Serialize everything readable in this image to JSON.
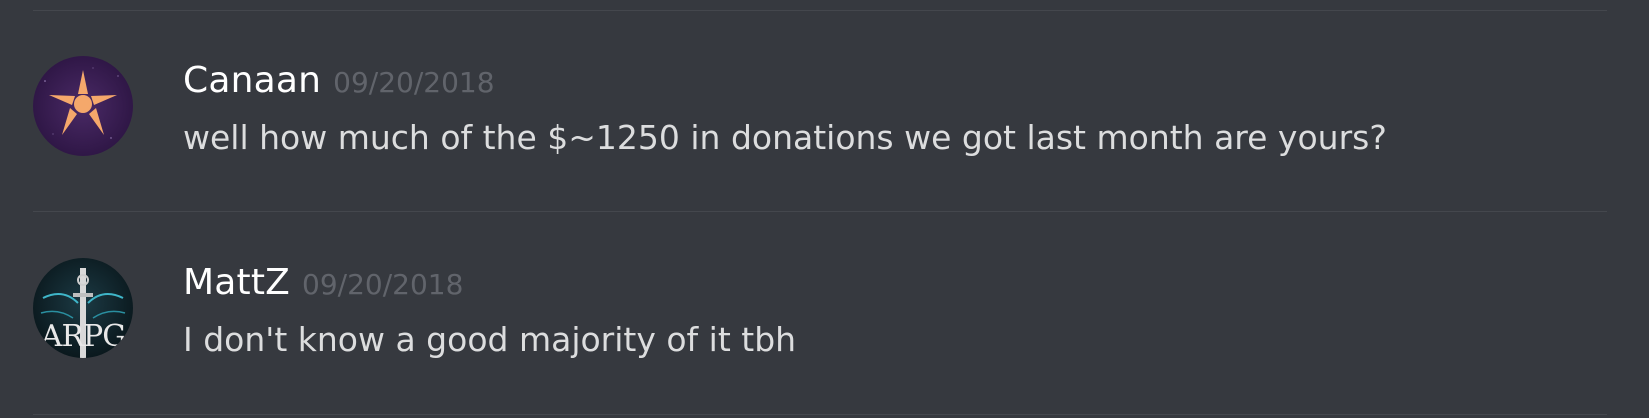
{
  "messages": [
    {
      "username": "Canaan",
      "timestamp": "09/20/2018",
      "text": "well how much of the $~1250 in donations we got last month are yours?",
      "avatar": "purple-star-icon"
    },
    {
      "username": "MattZ",
      "timestamp": "09/20/2018",
      "text": "I don't know a good majority of it tbh",
      "avatar": "sword-emblem-icon",
      "avatar_text": "ARPG"
    }
  ],
  "colors": {
    "background": "#36393f",
    "divider": "#44474d",
    "username": "#ffffff",
    "timestamp": "#61646b",
    "message_text": "#dcddde",
    "star": "#f5a86b",
    "avatar1_bg": "#3a1f52"
  }
}
